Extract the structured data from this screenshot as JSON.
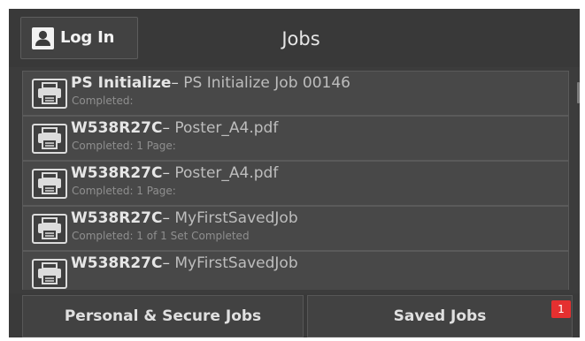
{
  "header": {
    "login_label": "Log In",
    "title": "Jobs"
  },
  "jobs": [
    {
      "id": "PS Initialize",
      "name": "PS Initialize Job 00146",
      "status": "Completed:"
    },
    {
      "id": "W538R27C",
      "name": "Poster_A4.pdf",
      "status": "Completed: 1 Page:"
    },
    {
      "id": "W538R27C",
      "name": "Poster_A4.pdf",
      "status": "Completed: 1 Page:"
    },
    {
      "id": "W538R27C",
      "name": "MyFirstSavedJob",
      "status": "Completed: 1 of 1 Set Completed"
    },
    {
      "id": "W538R27C",
      "name": "MyFirstSavedJob",
      "status": ""
    }
  ],
  "separator": "–",
  "footer": {
    "personal_secure_label": "Personal & Secure Jobs",
    "saved_jobs_label": "Saved Jobs",
    "saved_jobs_badge": "1"
  },
  "icons": {
    "login": "user-icon",
    "job": "printer-icon"
  },
  "colors": {
    "background": "#3c3c3c",
    "badge": "#e53030",
    "text": "#e6e6e6"
  }
}
